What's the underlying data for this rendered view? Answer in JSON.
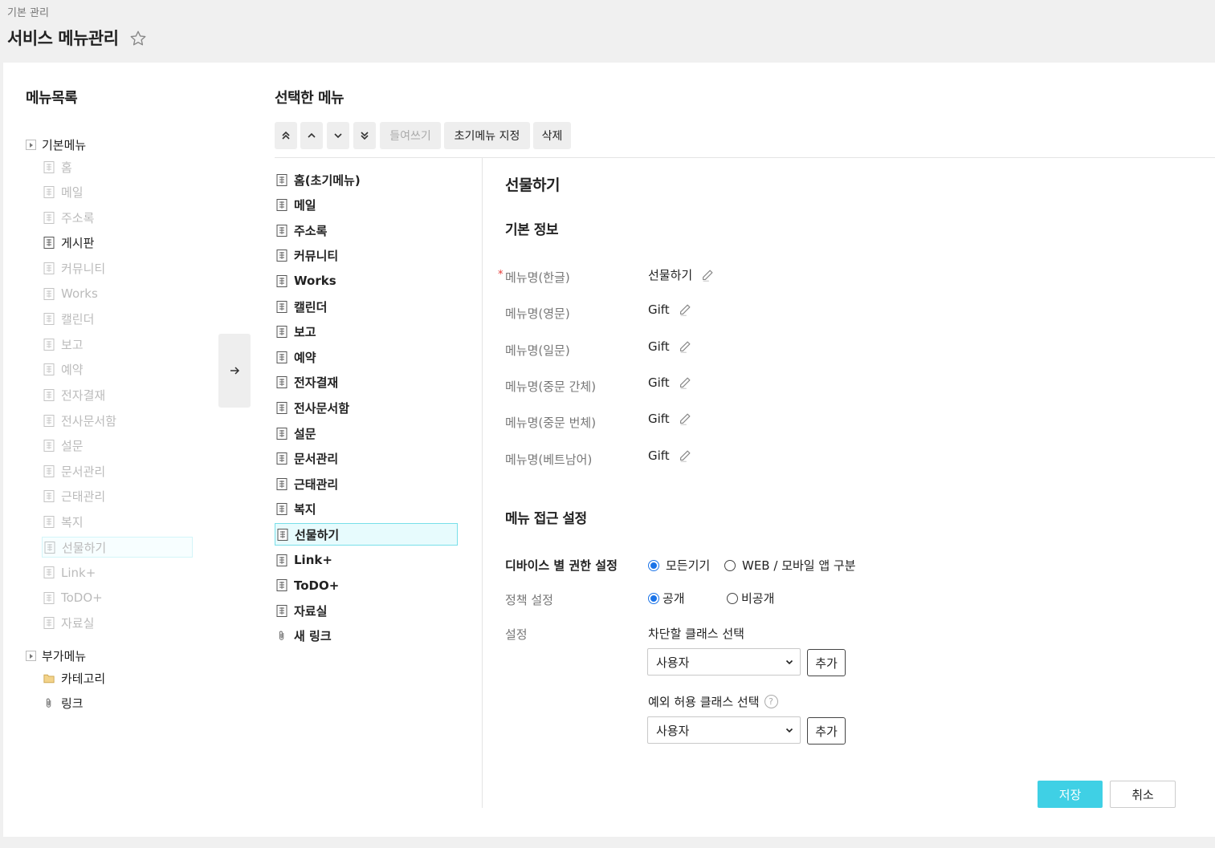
{
  "header": {
    "breadcrumb": "기본 관리",
    "title": "서비스 메뉴관리"
  },
  "left": {
    "title": "메뉴목록",
    "basic_group": "기본메뉴",
    "basic_items": [
      {
        "label": "홈",
        "enabled": false
      },
      {
        "label": "메일",
        "enabled": false
      },
      {
        "label": "주소록",
        "enabled": false
      },
      {
        "label": "게시판",
        "enabled": true
      },
      {
        "label": "커뮤니티",
        "enabled": false
      },
      {
        "label": "Works",
        "enabled": false
      },
      {
        "label": "캘린더",
        "enabled": false
      },
      {
        "label": "보고",
        "enabled": false
      },
      {
        "label": "예약",
        "enabled": false
      },
      {
        "label": "전자결재",
        "enabled": false
      },
      {
        "label": "전사문서함",
        "enabled": false
      },
      {
        "label": "설문",
        "enabled": false
      },
      {
        "label": "문서관리",
        "enabled": false
      },
      {
        "label": "근태관리",
        "enabled": false
      },
      {
        "label": "복지",
        "enabled": false
      },
      {
        "label": "선물하기",
        "enabled": false,
        "selected": true
      },
      {
        "label": "Link+",
        "enabled": false
      },
      {
        "label": "ToDO+",
        "enabled": false
      },
      {
        "label": "자료실",
        "enabled": false
      }
    ],
    "extra_group": "부가메뉴",
    "extra_items": [
      {
        "label": "카테고리",
        "icon": "folder-icon"
      },
      {
        "label": "링크",
        "icon": "paperclip-icon"
      }
    ]
  },
  "middle": {
    "title": "선택한 메뉴",
    "toolbar": {
      "indent": "들여쓰기",
      "set_initial": "초기메뉴 지정",
      "delete": "삭제"
    },
    "items": [
      {
        "label": "홈(초기메뉴)",
        "icon": "document-icon"
      },
      {
        "label": "메일",
        "icon": "document-icon"
      },
      {
        "label": "주소록",
        "icon": "document-icon"
      },
      {
        "label": "커뮤니티",
        "icon": "document-icon"
      },
      {
        "label": "Works",
        "icon": "document-icon"
      },
      {
        "label": "캘린더",
        "icon": "document-icon"
      },
      {
        "label": "보고",
        "icon": "document-icon"
      },
      {
        "label": "예약",
        "icon": "document-icon"
      },
      {
        "label": "전자결재",
        "icon": "document-icon"
      },
      {
        "label": "전사문서함",
        "icon": "document-icon"
      },
      {
        "label": "설문",
        "icon": "document-icon"
      },
      {
        "label": "문서관리",
        "icon": "document-icon"
      },
      {
        "label": "근태관리",
        "icon": "document-icon"
      },
      {
        "label": "복지",
        "icon": "document-icon"
      },
      {
        "label": "선물하기",
        "icon": "document-icon",
        "selected": true
      },
      {
        "label": "Link+",
        "icon": "document-icon"
      },
      {
        "label": "ToDO+",
        "icon": "document-icon"
      },
      {
        "label": "자료실",
        "icon": "document-icon"
      },
      {
        "label": "새 링크",
        "icon": "paperclip-icon"
      }
    ]
  },
  "detail": {
    "title": "선물하기",
    "basic_info_title": "기본 정보",
    "fields": [
      {
        "label": "메뉴명(한글)",
        "value": "선물하기",
        "required": true
      },
      {
        "label": "메뉴명(영문)",
        "value": "Gift"
      },
      {
        "label": "메뉴명(일문)",
        "value": "Gift"
      },
      {
        "label": "메뉴명(중문 간체)",
        "value": "Gift"
      },
      {
        "label": "메뉴명(중문 번체)",
        "value": "Gift"
      },
      {
        "label": "메뉴명(베트남어)",
        "value": "Gift"
      }
    ],
    "required_mark": "*",
    "access_title": "메뉴 접근 설정",
    "device_label": "디바이스 별 권한 설정",
    "device_options": [
      "모든기기",
      "WEB / 모바일 앱 구분"
    ],
    "policy_label": "정책 설정",
    "policy_options": [
      "공개",
      "비공개"
    ],
    "settings_label": "설정",
    "block_class_label": "차단할 클래스 선택",
    "block_select_value": "사용자",
    "add_label": "추가",
    "exception_class_label": "예외 허용 클래스 선택",
    "exception_select_value": "사용자",
    "help_mark": "?",
    "save": "저장",
    "cancel": "취소"
  },
  "colors": {
    "accent": "#3fd0e5",
    "radio": "#1a73e8",
    "required": "#e53935"
  }
}
